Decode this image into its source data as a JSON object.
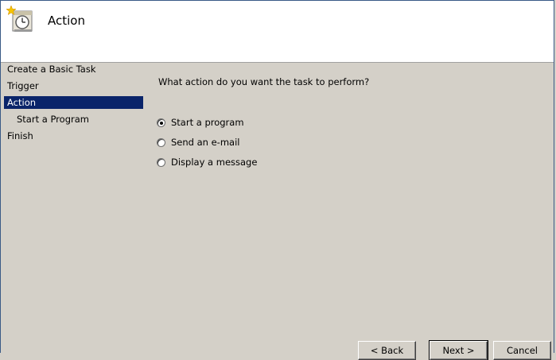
{
  "header": {
    "title": "Action"
  },
  "sidebar": {
    "items": [
      {
        "label": "Create a Basic Task"
      },
      {
        "label": "Trigger"
      },
      {
        "label": "Action"
      },
      {
        "label": "Start a Program"
      },
      {
        "label": "Finish"
      }
    ],
    "active_index": 2
  },
  "content": {
    "question": "What action do you want the task to perform?",
    "options": [
      {
        "label": "Start a program",
        "checked": true
      },
      {
        "label": "Send an e-mail",
        "checked": false
      },
      {
        "label": "Display a message",
        "checked": false
      }
    ]
  },
  "buttons": {
    "back_label": "< Back",
    "next_label": "Next >",
    "cancel_label": "Cancel"
  },
  "colors": {
    "window_bg": "#d4d0c8",
    "header_bg": "#ffffff",
    "selection_bg": "#0a246a",
    "selection_text": "#ffffff"
  },
  "icons": {
    "header_icon": "task-scheduler-clock-icon"
  }
}
